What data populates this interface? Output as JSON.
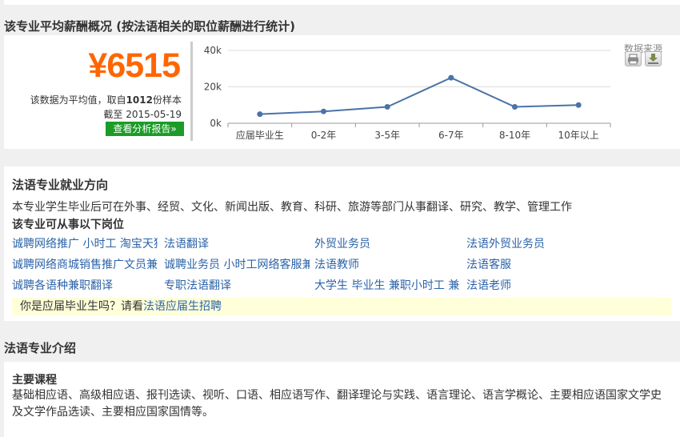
{
  "salary": {
    "title": "该专业平均薪酬概况 (按法语相关的职位薪酬进行统计)",
    "amount": "¥6515",
    "avg_prefix": "该数据为平均值，取自",
    "sample_count": "1012",
    "avg_suffix": "份样本",
    "date_prefix": "截至",
    "date": "2015-05-19",
    "report_button": "查看分析报告»",
    "data_source": "数据来源",
    "print_icon": "printer-icon",
    "download_icon": "download-icon"
  },
  "chart_data": {
    "type": "line",
    "categories": [
      "应届毕业生",
      "0-2年",
      "3-5年",
      "6-7年",
      "8-10年",
      "10年以上"
    ],
    "series": [
      {
        "values": [
          5000,
          6500,
          9000,
          25000,
          9000,
          10000
        ]
      }
    ],
    "y_ticks": [
      "0k",
      "20k",
      "40k"
    ],
    "ylim": [
      0,
      40000
    ],
    "grid": true,
    "line_color": "#4a73a8"
  },
  "career": {
    "title": "法语专业就业方向",
    "description": "本专业学生毕业后可在外事、经贸、文化、新闻出版、教育、科研、旅游等部门从事翻译、研究、教学、管理工作",
    "jobs_title": "该专业可从事以下岗位",
    "jobs": [
      [
        "诚聘网络推广 小时工 淘宝天猫",
        "法语翻译",
        "外贸业务员",
        "法语外贸业务员"
      ],
      [
        "诚聘网络商城销售推广文员兼职",
        "诚聘业务员 小时工网络客服兼职",
        "法语教师",
        "法语客服"
      ],
      [
        "诚聘各语种兼职翻译",
        "专职法语翻译",
        "大学生 毕业生 兼职小时工 兼职",
        "法语老师"
      ]
    ],
    "grad_prefix": "你是应届毕业生吗？请看",
    "grad_link": "法语应届生招聘"
  },
  "intro": {
    "title": "法语专业介绍",
    "courses_title": "主要课程",
    "courses_text": "基础相应语、高级相应语、报刊选读、视听、口语、相应语写作、翻译理论与实践、语言理论、语言学概论、主要相应语国家文学史及文学作品选读、主要相应国家国情等。"
  }
}
